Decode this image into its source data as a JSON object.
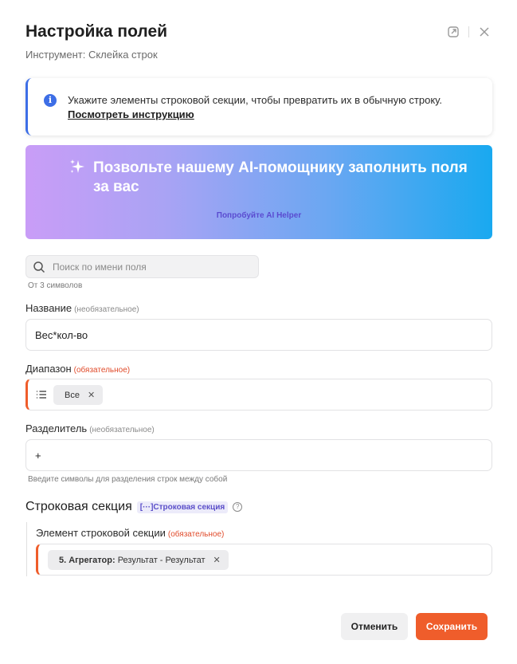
{
  "header": {
    "title": "Настройка полей",
    "subtitle": "Инструмент: Склейка строк"
  },
  "info": {
    "text": "Укажите элементы строковой секции, чтобы превратить их в обычную строку.",
    "link": "Посмотреть инструкцию"
  },
  "ai_banner": {
    "title": "Позвольте нашему AI-помощнику заполнить поля за вас",
    "cta": "Попробуйте AI Helper"
  },
  "search": {
    "placeholder": "Поиск по имени поля",
    "hint": "От 3 символов"
  },
  "fields": {
    "name": {
      "label": "Название",
      "qualifier": "(необязательное)",
      "value": "Вес*кол-во"
    },
    "range": {
      "label": "Диапазон",
      "qualifier": "(обязательное)",
      "chip": "Все"
    },
    "separator": {
      "label": "Разделитель",
      "qualifier": "(необязательное)",
      "value": "+",
      "hint": "Введите символы для разделения строк между собой"
    }
  },
  "row_section": {
    "title": "Строковая секция",
    "badge": "Строковая секция",
    "element_label": "Элемент строковой секции",
    "element_qualifier": "(обязательное)",
    "chip_bold": "5. Агрегатор:",
    "chip_rest": "Результат - Результат"
  },
  "buttons": {
    "cancel": "Отменить",
    "save": "Сохранить"
  },
  "colors": {
    "accent": "#ef5d2b",
    "info": "#3d6ee6",
    "badge": "#5b4fc9"
  }
}
